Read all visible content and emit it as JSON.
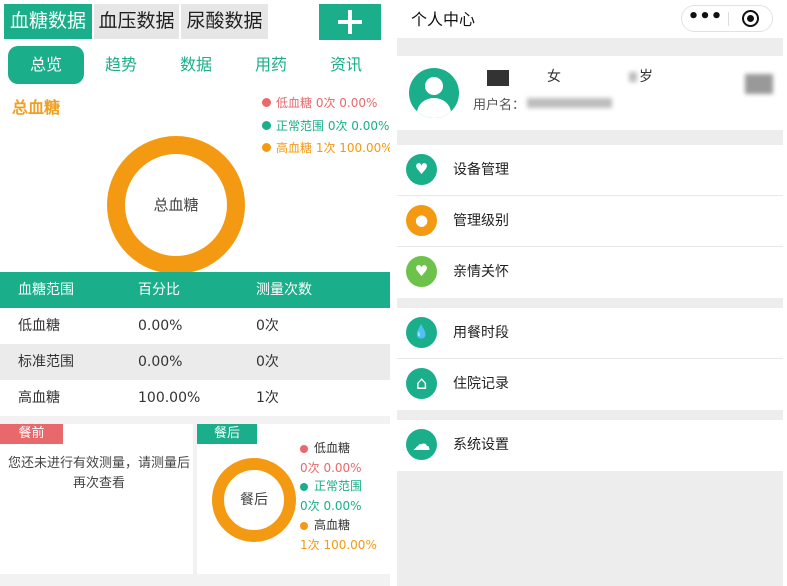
{
  "left": {
    "top_tabs": [
      "血糖数据",
      "血压数据",
      "尿酸数据"
    ],
    "add_icon": "plus-icon",
    "sub_tabs": [
      "总览",
      "趋势",
      "数据",
      "用药",
      "资讯"
    ],
    "summary": {
      "title": "总血糖",
      "donut_label": "总血糖",
      "legend": [
        {
          "text": "低血糖 0次 0.00%",
          "color": "#e8686b"
        },
        {
          "text": "正常范围 0次 0.00%",
          "color": "#1aae8a"
        },
        {
          "text": "高血糖 1次 100.00%",
          "color": "#f39a12"
        }
      ]
    },
    "table": {
      "headers": [
        "血糖范围",
        "百分比",
        "测量次数"
      ],
      "rows": [
        [
          "低血糖",
          "0.00%",
          "0次"
        ],
        [
          "标准范围",
          "0.00%",
          "0次"
        ],
        [
          "高血糖",
          "100.00%",
          "1次"
        ]
      ]
    },
    "before_meal": {
      "tag": "餐前",
      "tag_color": "#e8686b",
      "empty_text": "您还未进行有效测量，请测量后再次查看"
    },
    "after_meal": {
      "tag": "餐后",
      "tag_color": "#1aae8a",
      "donut_label": "餐后",
      "legend": [
        {
          "name": "低血糖",
          "value": "0次 0.00%",
          "color": "#e8686b"
        },
        {
          "name": "正常范围",
          "value": "0次 0.00%",
          "color": "#1aae8a"
        },
        {
          "name": "高血糖",
          "value": "1次 100.00%",
          "color": "#f39a12"
        }
      ]
    }
  },
  "right": {
    "title": "个人中心",
    "capsule_more": "•••",
    "profile": {
      "gender": "女",
      "age_unit": "岁",
      "username_label": "用户名："
    },
    "menu_groups": [
      [
        {
          "label": "设备管理",
          "icon": "heart-pulse-icon",
          "color": "#1aae8a",
          "glyph": "♥"
        },
        {
          "label": "管理级别",
          "icon": "user-icon",
          "color": "#f39a12",
          "glyph": "●"
        },
        {
          "label": "亲情关怀",
          "icon": "heart-icon",
          "color": "#6cc24a",
          "glyph": "♥"
        }
      ],
      [
        {
          "label": "用餐时段",
          "icon": "water-drop-icon",
          "color": "#1aae8a",
          "glyph": "💧"
        },
        {
          "label": "住院记录",
          "icon": "home-icon",
          "color": "#1aae8a",
          "glyph": "⌂"
        }
      ],
      [
        {
          "label": "系统设置",
          "icon": "cloud-icon",
          "color": "#1aae8a",
          "glyph": "☁"
        }
      ]
    ]
  }
}
